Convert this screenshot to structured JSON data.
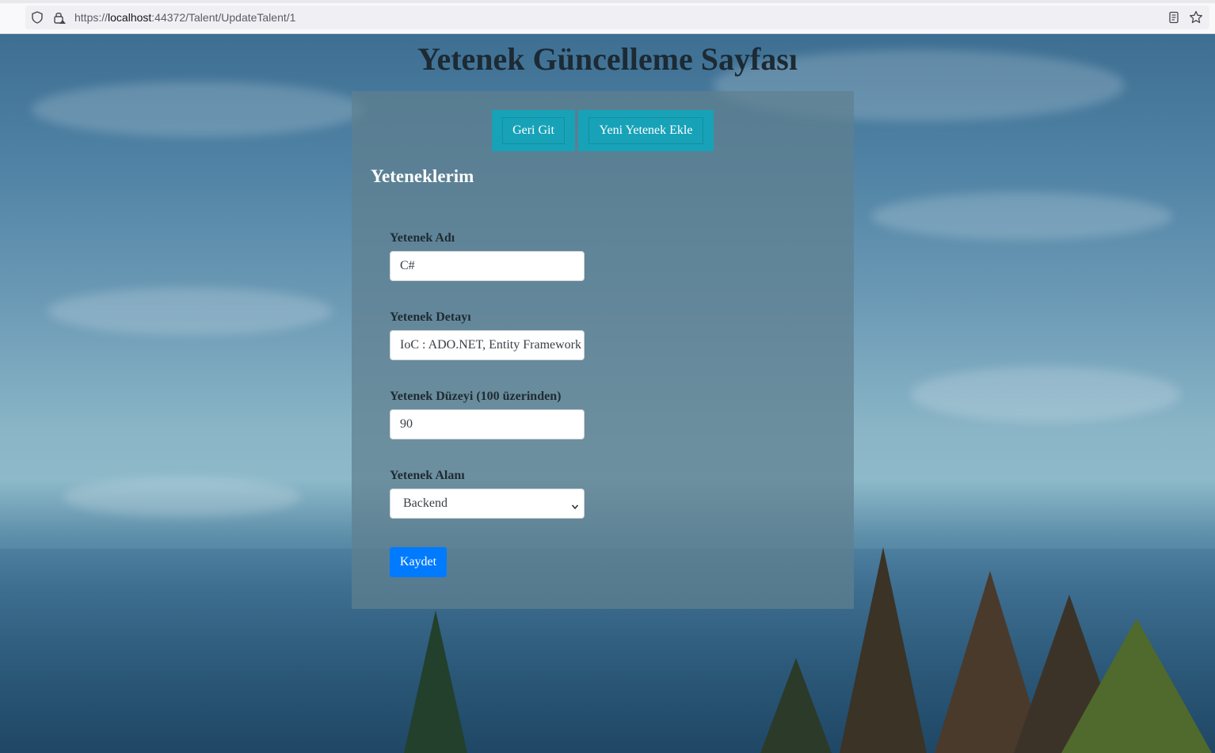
{
  "browser": {
    "url_prefix": "https://",
    "url_host": "localhost",
    "url_path": ":44372/Talent/UpdateTalent/1",
    "icons": [
      "shield-icon",
      "lock-icon",
      "reader-view-icon",
      "bookmark-star-icon"
    ]
  },
  "page": {
    "title": "Yetenek Güncelleme Sayfası"
  },
  "toolbar": {
    "back_label": "Geri Git",
    "add_label": "Yeni Yetenek Ekle"
  },
  "section": {
    "title": "Yeteneklerim"
  },
  "form": {
    "name_label": "Yetenek Adı",
    "name_value": "C#",
    "detail_label": "Yetenek Detayı",
    "detail_value": "IoC : ADO.NET, Entity Framework",
    "level_label": "Yetenek Düzeyi (100 üzerinden)",
    "level_value": "90",
    "area_label": "Yetenek Alanı",
    "area_selected": "Backend",
    "save_label": "Kaydet"
  },
  "colors": {
    "teal_button": "#17a2b8",
    "primary_button": "#007bff"
  }
}
